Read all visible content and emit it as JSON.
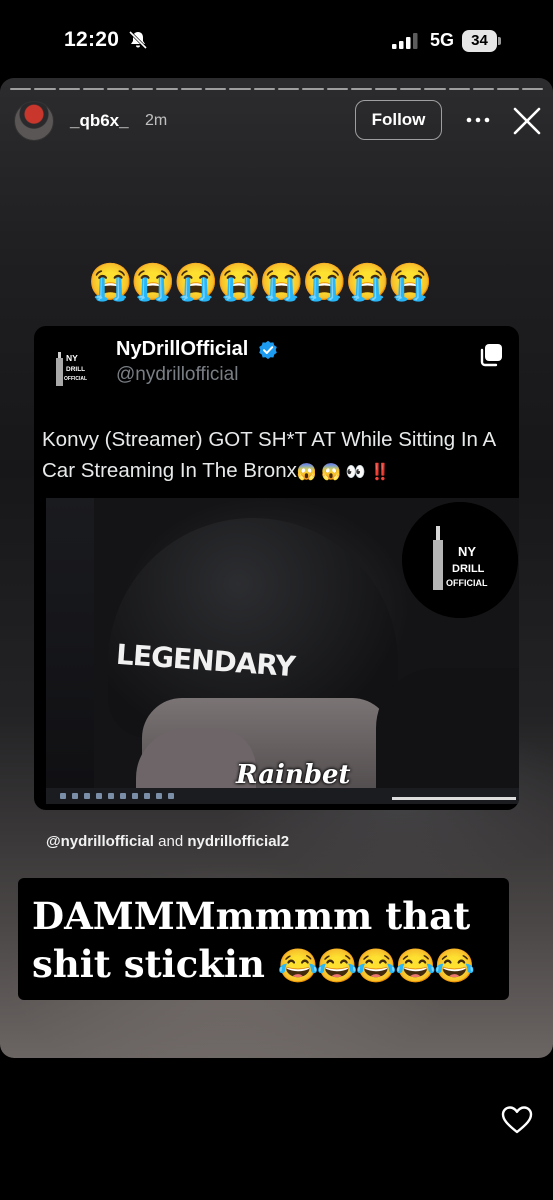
{
  "status_bar": {
    "time": "12:20",
    "network": "5G",
    "battery": "34",
    "icons": [
      "bell-slash-icon",
      "signal-bars-icon",
      "battery-icon"
    ]
  },
  "story": {
    "segments": 22,
    "header": {
      "username": "_qb6x_",
      "time_ago": "2m",
      "follow_label": "Follow",
      "icons": [
        "more-icon",
        "close-icon"
      ]
    },
    "emoji_row": "😭😭😭😭😭😭😭😭",
    "tweet": {
      "logo_text": [
        "NY",
        "DRILL",
        "OFFICIAL"
      ],
      "name": "NyDrillOfficial",
      "handle": "@nydrillofficial",
      "text": "Konvy (Streamer) GOT SH*T AT While Sitting In A Car Streaming In The Bronx",
      "text_emojis": "😱 😱 👀 ‼️",
      "media": {
        "beanie_text": "LEGENDARY",
        "watermark_text": [
          "NY",
          "DRILL",
          "OFFICIAL"
        ],
        "brand": "Rainbet"
      },
      "accent_color": "#1d9bf0"
    },
    "mentions": {
      "first": "@nydrillofficial",
      "joiner": "and",
      "second": "nydrillofficial2"
    },
    "caption": {
      "line1": "DAMMMmmmm that",
      "line2": "shit stickin",
      "emojis": "😂😂😂😂😂"
    }
  },
  "footer": {
    "icons": [
      "heart-icon"
    ]
  }
}
